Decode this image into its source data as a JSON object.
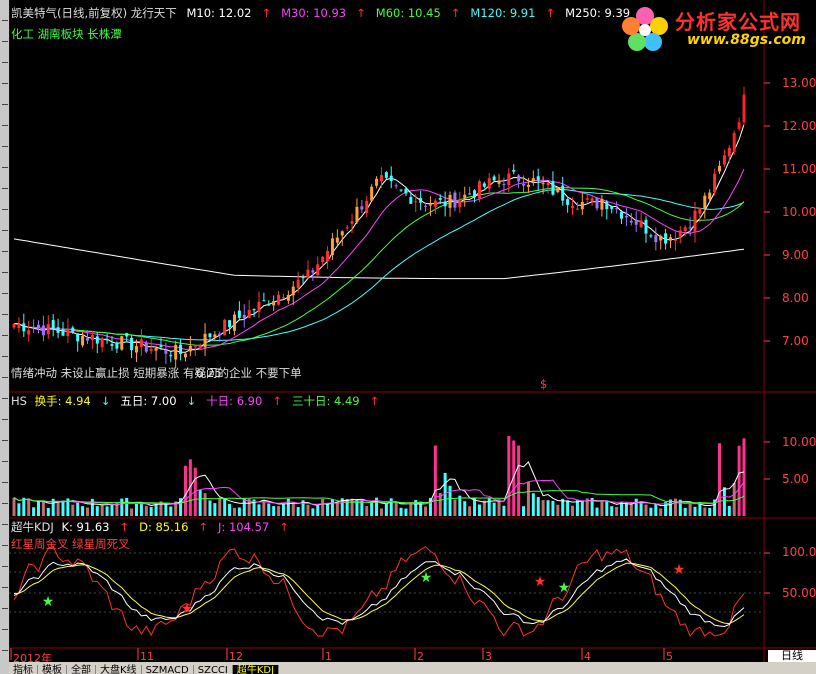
{
  "main_header": {
    "title": "凯美特气(日线,前复权) 龙行天下",
    "ma_items": [
      {
        "label": "M10: 12.02",
        "arrow": "↑",
        "color": "#ffffff"
      },
      {
        "label": "M30: 10.93",
        "arrow": "↑",
        "color": "#ff40ff"
      },
      {
        "label": "M60: 10.45",
        "arrow": "↑",
        "color": "#40ff40"
      },
      {
        "label": "M120: 9.91",
        "arrow": "↑",
        "color": "#40ffff"
      },
      {
        "label": "M250: 9.39",
        "arrow": "↑",
        "color": "#ffffff"
      }
    ],
    "sector": "化工 湖南板块 长株潭"
  },
  "main_note": {
    "text": "情绪冲动  未设止赢止损  短期暴涨  有疑问的企业  不要下单",
    "price_label": "6.25",
    "marker": "$"
  },
  "main_axis": [
    "13.00",
    "12.00",
    "11.00",
    "10.00",
    "9.00",
    "8.00",
    "7.00"
  ],
  "volume_header": {
    "name": "HS",
    "items": [
      {
        "label": "换手: 4.94",
        "arrow": "↓",
        "color": "#ffff00"
      },
      {
        "label": "五日: 7.00",
        "arrow": "↓",
        "color": "#ffffff"
      },
      {
        "label": "十日: 6.90",
        "arrow": "↑",
        "color": "#ff40ff"
      },
      {
        "label": "三十日: 4.49",
        "arrow": "↑",
        "color": "#40ff40"
      }
    ]
  },
  "volume_axis": [
    "10.00",
    "5.00"
  ],
  "kdj_header": {
    "name": "超牛KDJ",
    "items": [
      {
        "label": "K: 91.63",
        "arrow": "↑",
        "color": "#ffffff"
      },
      {
        "label": "D: 85.16",
        "arrow": "↑",
        "color": "#ffff00"
      },
      {
        "label": "J: 104.57",
        "arrow": "↑",
        "color": "#ff40ff"
      }
    ],
    "legend": "红星周金叉 绿星周死叉"
  },
  "kdj_axis": [
    "100.00",
    "50.00"
  ],
  "x_axis": [
    "2012年",
    "11",
    "12",
    "1",
    "2",
    "3",
    "4",
    "5"
  ],
  "period": "日线",
  "tabs": [
    "指标",
    "模板",
    "全部",
    "大盘K线",
    "SZMACD",
    "SZCCI",
    "超牛KDJ"
  ],
  "logo": {
    "title": "分析家公式网",
    "url": "www.88gs.com"
  },
  "colors": {
    "up": "#ff3030",
    "down": "#40ffff",
    "ma10": "#ffffff",
    "ma30": "#ff40ff",
    "ma60": "#40ff40",
    "ma120": "#40ffff",
    "ma250": "#ffffff",
    "grid": "#8b0000"
  }
}
